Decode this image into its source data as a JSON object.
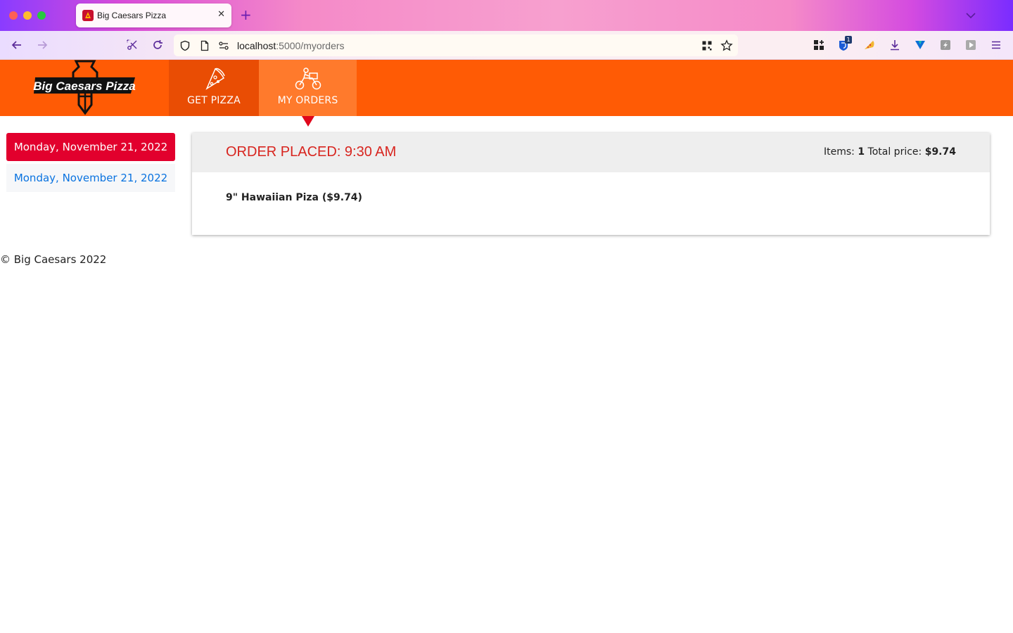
{
  "browser": {
    "tab_title": "Big Caesars Pizza",
    "tab_close": "✕",
    "new_tab": "+",
    "url_host": "localhost",
    "url_path": ":5000/myorders",
    "extension_badge": "1"
  },
  "site": {
    "logo_text": "Big Caesars Pizza",
    "nav": {
      "get_pizza": "GET PIZZA",
      "my_orders": "MY ORDERS"
    }
  },
  "dates": {
    "active": "Monday, November 21, 2022",
    "other": "Monday, November 21, 2022"
  },
  "order": {
    "title": "ORDER PLACED: 9:30 AM",
    "items_label": "Items:",
    "items_count": "1",
    "total_label": "Total price:",
    "total_value": "$9.74",
    "item_line": "9\" Hawaiian Piza ($9.74)"
  },
  "footer": {
    "text": "© Big Caesars 2022"
  },
  "colors": {
    "header": "#ff5b05",
    "nav_active": "#ff7a2c",
    "date_active_bg": "#e2002d",
    "order_title": "#d8251f",
    "link": "#0a73e0"
  }
}
